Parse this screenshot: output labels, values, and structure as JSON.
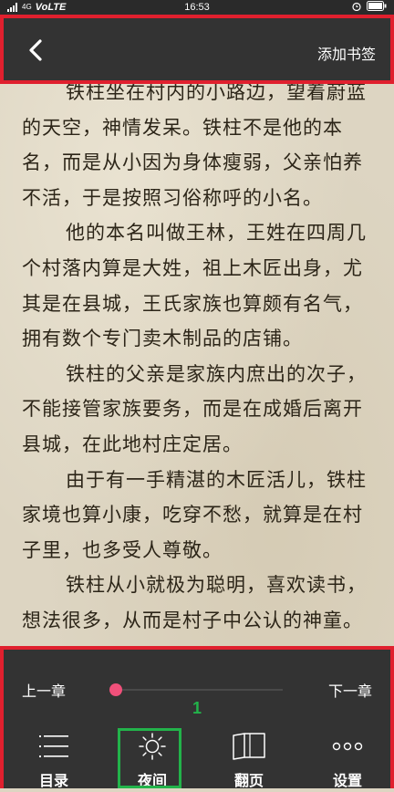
{
  "status_bar": {
    "network": "4G",
    "carrier": "VoLTE",
    "time": "16:53"
  },
  "header": {
    "back_icon": "chevron-left-icon",
    "bookmark_label": "添加书签"
  },
  "reader": {
    "paragraphs": [
      "铁柱坐在村内的小路边，望着蔚蓝的天空，神情发呆。铁柱不是他的本名，而是从小因为身体瘦弱，父亲怕养不活，于是按照习俗称呼的小名。",
      "他的本名叫做王林，王姓在四周几个村落内算是大姓，祖上木匠出身，尤其是在县城，王氏家族也算颇有名气，拥有数个专门卖木制品的店铺。",
      "铁柱的父亲是家族内庶出的次子，不能接管家族要务，而是在成婚后离开县城，在此地村庄定居。",
      "由于有一手精湛的木匠活儿，铁柱家境也算小康，吃穿不愁，就算是在村子里，也多受人尊敬。",
      "铁柱从小就极为聪明，喜欢读书，想法很多，从而是村子中公认的神童。"
    ]
  },
  "bottom_panel": {
    "prev_chapter_label": "上一章",
    "next_chapter_label": "下一章",
    "chapter_progress": 0.03,
    "progress_color": "#f0507a",
    "step_badge": "1",
    "toolbar": [
      {
        "key": "catalog",
        "label": "目录",
        "icon": "list-icon"
      },
      {
        "key": "night",
        "label": "夜间",
        "icon": "sun-icon"
      },
      {
        "key": "page",
        "label": "翻页",
        "icon": "book-icon"
      },
      {
        "key": "settings",
        "label": "设置",
        "icon": "more-dots-icon"
      }
    ]
  },
  "colors": {
    "bar_background": "#333333",
    "page_background": "#ddd5c2",
    "highlight_red": "#e0202e",
    "highlight_green": "#22b34a"
  }
}
